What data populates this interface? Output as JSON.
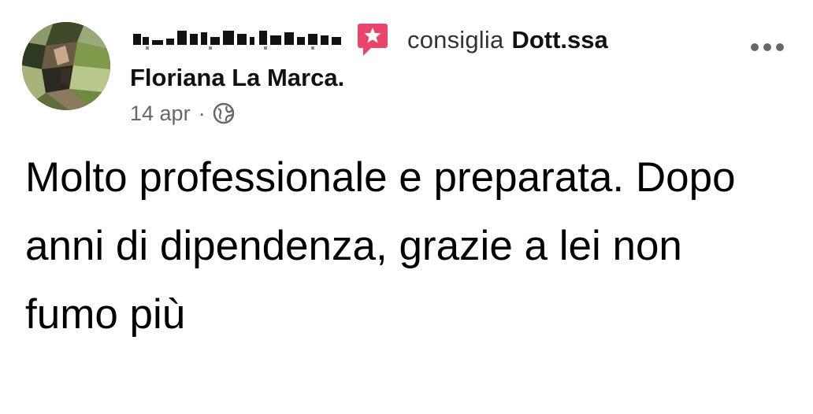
{
  "post": {
    "author_name_blurred": "",
    "verb": "consiglia",
    "target_line1": "Dott.ssa",
    "target_line2": "Floriana La Marca.",
    "date": "14 apr",
    "separator": "·",
    "privacy_icon": "globe-icon",
    "recommend_icon": "recommend-star-icon",
    "more_icon": "more-horizontal-icon",
    "body": "Molto professionale e preparata. Dopo anni di dipendenza, grazie a lei non fumo più"
  },
  "colors": {
    "recommend_red": "#e8456b",
    "meta_gray": "#65676b",
    "text": "#000000"
  }
}
